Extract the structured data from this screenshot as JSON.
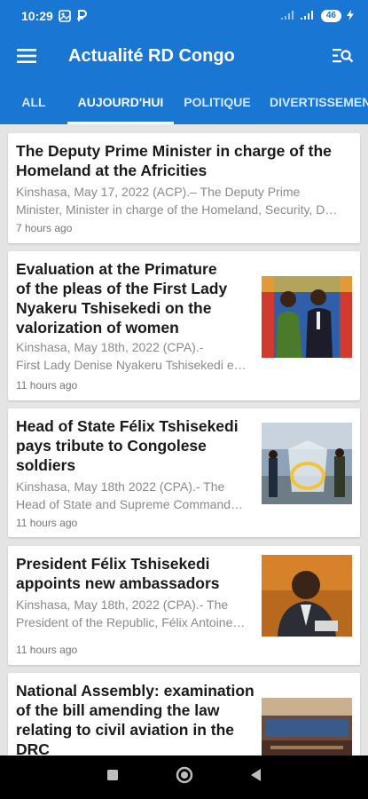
{
  "status_bar": {
    "time": "10:29",
    "battery": "46"
  },
  "app_bar": {
    "title": "Actualité RD Congo",
    "menu_icon": "menu-icon",
    "search_icon": "search-list-icon"
  },
  "tabs": [
    {
      "label": "ALL"
    },
    {
      "label": "AUJOURD'HUI",
      "selected": true
    },
    {
      "label": "POLITIQUE"
    },
    {
      "label": "DIVERTISSEMENT"
    }
  ],
  "articles": [
    {
      "headline": [
        "The Deputy Prime Minister in charge of the",
        "Homeland at the Africities"
      ],
      "snippet": [
        "Kinshasa, May 17, 2022 (ACP).– The Deputy Prime",
        "Minister, Minister in charge of the Homeland, Security, D…"
      ],
      "age": "7 hours ago"
    },
    {
      "headline": [
        "Evaluation at the Primature",
        "of the pleas of the First Lady",
        "Nyakeru Tshisekedi on the",
        "valorization of women"
      ],
      "snippet": [
        "Kinshasa, May 18th, 2022 (CPA).-",
        "First Lady Denise Nyakeru Tshisekedi e…"
      ],
      "age": "11 hours ago"
    },
    {
      "headline": [
        "Head of State Félix Tshisekedi",
        "pays tribute to Congolese",
        "soldiers"
      ],
      "snippet": [
        "Kinshasa, May 18th 2022 (CPA).- The",
        "Head of State and Supreme Command…"
      ],
      "age": "11 hours ago"
    },
    {
      "headline": [
        "President Félix Tshisekedi",
        "appoints new ambassadors"
      ],
      "snippet": [
        "Kinshasa, May 18th, 2022 (CPA).- The",
        "President of the Republic, Félix Antoine…"
      ],
      "age": "11 hours ago"
    },
    {
      "headline": [
        "National Assembly: examination",
        "of the bill amending the law",
        "relating to civil aviation in the",
        "DRC"
      ],
      "snippet": [],
      "age": ""
    }
  ],
  "colors": {
    "primary": "#1976d2",
    "background": "#e4e4e4"
  }
}
